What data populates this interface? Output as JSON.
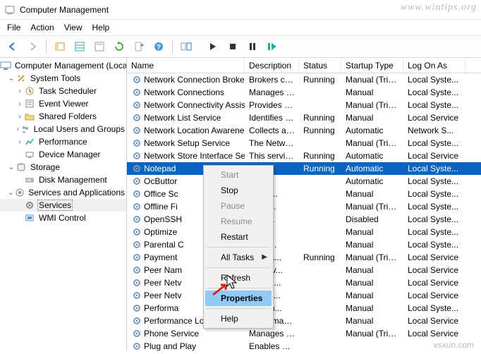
{
  "window_title": "Computer Management",
  "watermark": "www.wintips.org",
  "vsxun": "vsxun.com",
  "menubar": [
    "File",
    "Action",
    "View",
    "Help"
  ],
  "tree": {
    "root": {
      "label": "Computer Management (Local"
    },
    "system_tools": {
      "label": "System Tools",
      "children": [
        "Task Scheduler",
        "Event Viewer",
        "Shared Folders",
        "Local Users and Groups",
        "Performance",
        "Device Manager"
      ]
    },
    "storage": {
      "label": "Storage",
      "children": [
        "Disk Management"
      ]
    },
    "services_apps": {
      "label": "Services and Applications",
      "children": [
        "Services",
        "WMI Control"
      ]
    }
  },
  "columns": {
    "name": "Name",
    "description": "Description",
    "status": "Status",
    "startup": "Startup Type",
    "logon": "Log On As"
  },
  "services": [
    {
      "name": "Network Connection Broker",
      "desc": "Brokers con...",
      "status": "Running",
      "startup": "Manual (Trig...",
      "logon": "Local Syste..."
    },
    {
      "name": "Network Connections",
      "desc": "Manages o...",
      "status": "",
      "startup": "Manual",
      "logon": "Local Syste..."
    },
    {
      "name": "Network Connectivity Assis...",
      "desc": "Provides Dir...",
      "status": "",
      "startup": "Manual (Trig...",
      "logon": "Local Syste..."
    },
    {
      "name": "Network List Service",
      "desc": "Identifies th...",
      "status": "Running",
      "startup": "Manual",
      "logon": "Local Service"
    },
    {
      "name": "Network Location Awareness",
      "desc": "Collects an...",
      "status": "Running",
      "startup": "Automatic",
      "logon": "Network S..."
    },
    {
      "name": "Network Setup Service",
      "desc": "The Networ...",
      "status": "",
      "startup": "Manual (Trig...",
      "logon": "Local Syste..."
    },
    {
      "name": "Network Store Interface Ser...",
      "desc": "This service ...",
      "status": "Running",
      "startup": "Automatic",
      "logon": "Local Service"
    },
    {
      "name": "Notepad",
      "desc": "",
      "status": "Running",
      "startup": "Automatic",
      "logon": "Local Syste...",
      "selected": true
    },
    {
      "name": "OcButtor",
      "desc": "",
      "status": "",
      "startup": "Automatic",
      "logon": "Local Syste..."
    },
    {
      "name": "Office  Sc",
      "desc": "install...",
      "status": "",
      "startup": "Manual",
      "logon": "Local Syste..."
    },
    {
      "name": "Offline Fi",
      "desc": "ffline ...",
      "status": "",
      "startup": "Manual (Trig...",
      "logon": "Local Syste..."
    },
    {
      "name": "OpenSSH",
      "desc": "to ho...",
      "status": "",
      "startup": "Disabled",
      "logon": "Local Syste..."
    },
    {
      "name": "Optimize",
      "desc": "the c...",
      "status": "",
      "startup": "Manual",
      "logon": "Local Syste..."
    },
    {
      "name": "Parental C",
      "desc": "es pa...",
      "status": "",
      "startup": "Manual",
      "logon": "Local Syste..."
    },
    {
      "name": "Payment",
      "desc": "ges pa...",
      "status": "Running",
      "startup": "Manual (Trig...",
      "logon": "Local Service"
    },
    {
      "name": "Peer Nam",
      "desc": "es serv...",
      "status": "",
      "startup": "Manual",
      "logon": "Local Service"
    },
    {
      "name": "Peer Netv",
      "desc": "es mul...",
      "status": "",
      "startup": "Manual",
      "logon": "Local Service"
    },
    {
      "name": "Peer Netv",
      "desc": "les ide...",
      "status": "",
      "startup": "Manual",
      "logon": "Local Service"
    },
    {
      "name": "Performa",
      "desc": "es rem...",
      "status": "",
      "startup": "Manual",
      "logon": "Local Syste..."
    },
    {
      "name": "Performance Logs & Alerts",
      "desc": "Performanc...",
      "status": "",
      "startup": "Manual",
      "logon": "Local Service"
    },
    {
      "name": "Phone Service",
      "desc": "Manages th...",
      "status": "",
      "startup": "Manual (Trig...",
      "logon": "Local Service"
    },
    {
      "name": "Plug and Play",
      "desc": "Enables a c...",
      "status": "",
      "startup": "",
      "logon": ""
    }
  ],
  "context_menu": [
    {
      "label": "Start",
      "disabled": true
    },
    {
      "label": "Stop"
    },
    {
      "label": "Pause",
      "disabled": true
    },
    {
      "label": "Resume",
      "disabled": true
    },
    {
      "label": "Restart"
    },
    {
      "sep": true
    },
    {
      "label": "All Tasks",
      "submenu": true
    },
    {
      "sep": true
    },
    {
      "label": "Refresh"
    },
    {
      "sep": true
    },
    {
      "label": "Properties",
      "hilite": true
    },
    {
      "sep": true
    },
    {
      "label": "Help"
    }
  ]
}
